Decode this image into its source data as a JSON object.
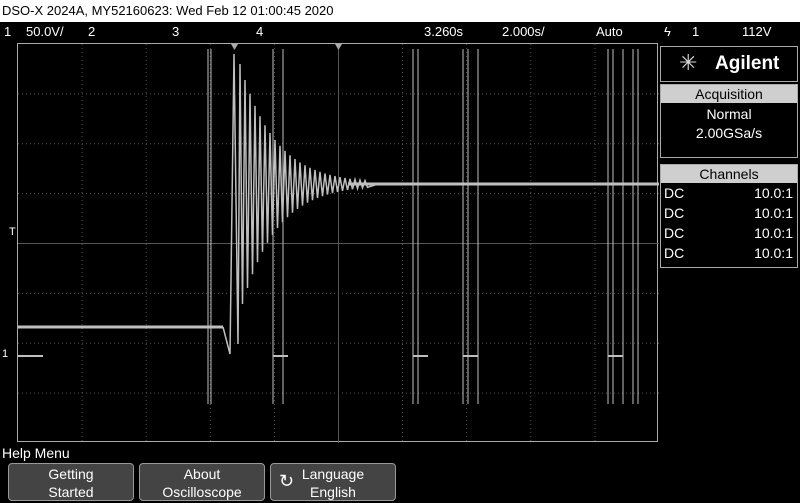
{
  "title": "DSO-X 2024A, MY52160623: Wed Feb 12 01:00:45 2020",
  "status": {
    "ch1": "1",
    "ch1_scale": "50.0V/",
    "ch2": "2",
    "ch3": "3",
    "ch4": "4",
    "time_delay": "3.260s",
    "time_scale": "2.000s/",
    "trigger_mode": "Auto",
    "trigger_icon": "trigger-edge-icon",
    "trigger_ch": "1",
    "trigger_level": "112V"
  },
  "brand": "Agilent",
  "acquisition": {
    "header": "Acquisition",
    "mode": "Normal",
    "rate": "2.00GSa/s"
  },
  "channels": {
    "header": "Channels",
    "rows": [
      {
        "coupling": "DC",
        "probe": "10.0:1"
      },
      {
        "coupling": "DC",
        "probe": "10.0:1"
      },
      {
        "coupling": "DC",
        "probe": "10.0:1"
      },
      {
        "coupling": "DC",
        "probe": "10.0:1"
      }
    ]
  },
  "markers": {
    "trigger": "T",
    "ch1_ground": "1"
  },
  "help_menu": "Help Menu",
  "softkeys": [
    {
      "line1": "Getting",
      "line2": "Started"
    },
    {
      "line1": "About",
      "line2": "Oscilloscope"
    },
    {
      "line1": "Language",
      "line2": "English",
      "icon": "rotate-icon"
    }
  ],
  "colors": {
    "background": "#000000",
    "trace": "#bfbfbf",
    "header": "#cfcfcf"
  }
}
